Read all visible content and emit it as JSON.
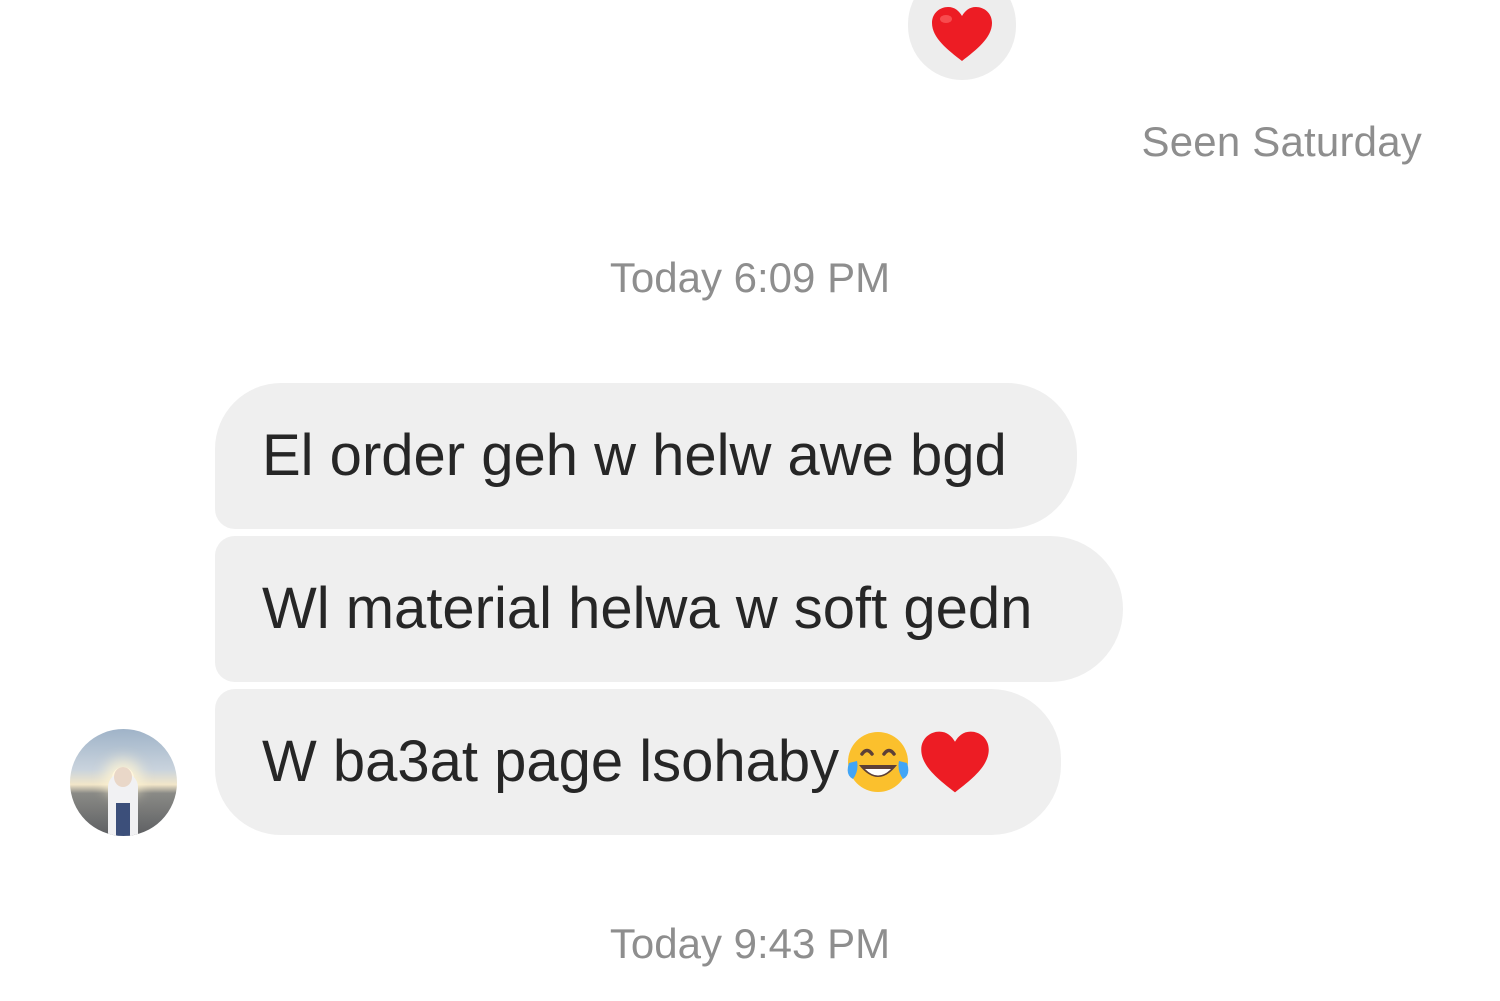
{
  "top_reaction": {
    "icon": "heart-icon",
    "color": "#ed1c24"
  },
  "seen_status": "Seen Saturday",
  "timestamps": [
    "Today 6:09 PM",
    "Today 9:43 PM"
  ],
  "messages": [
    {
      "text": "El order geh w helw awe bgd"
    },
    {
      "text": "Wl material helwa w soft gedn"
    },
    {
      "text": "W ba3at page lsohaby",
      "emojis": [
        "face-with-tears-of-joy-icon",
        "heart-icon"
      ]
    }
  ],
  "colors": {
    "incoming_bubble": "#efefef",
    "reaction_bubble": "#ededed",
    "meta_text": "#8e8e8e",
    "message_text": "#262626"
  }
}
